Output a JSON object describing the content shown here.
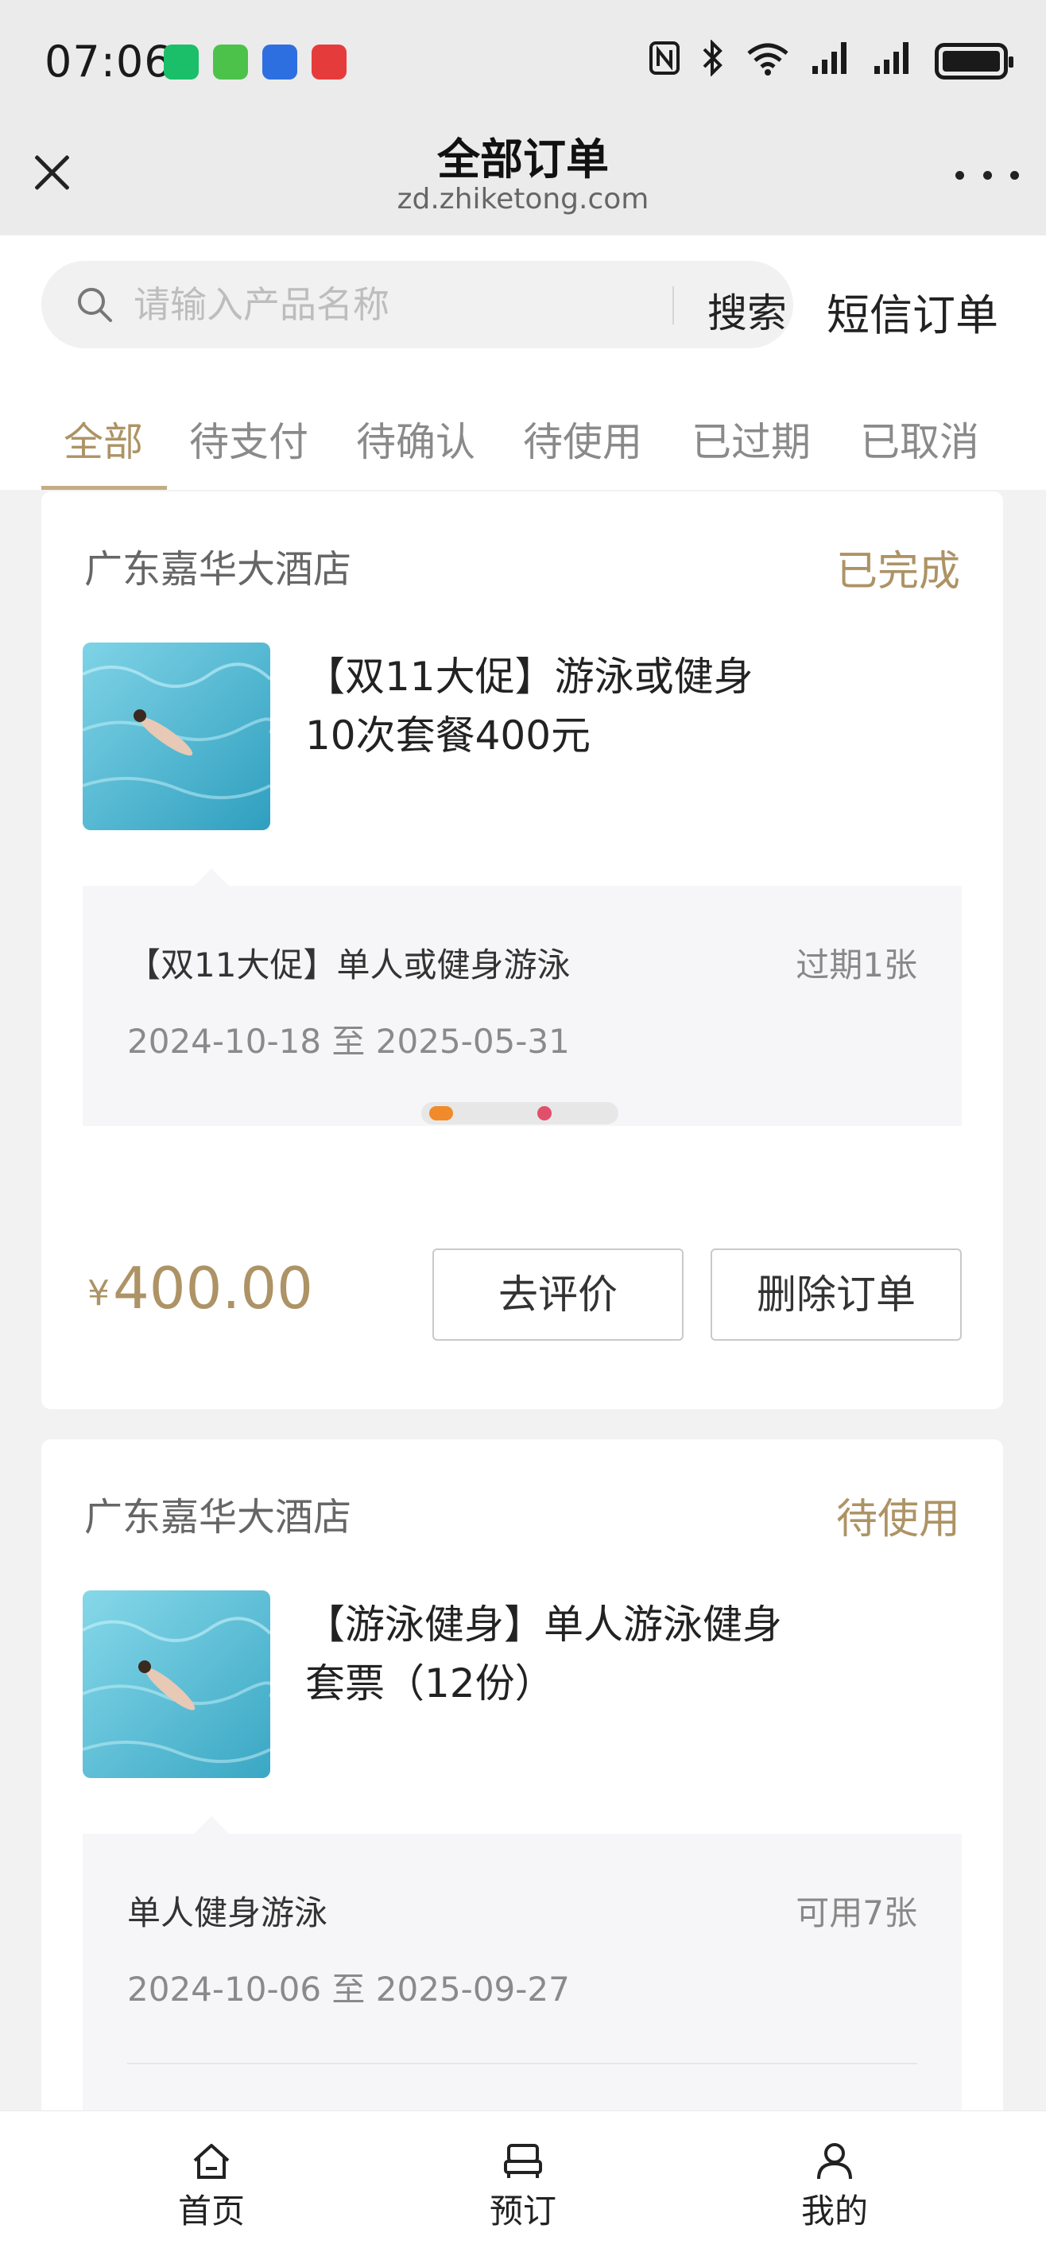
{
  "status_bar": {
    "time": "07:06",
    "app_icons": [
      {
        "name": "mi-home-app-icon",
        "color": "#1bbf6a"
      },
      {
        "name": "spreadsheet-app-icon",
        "color": "#4cc24a"
      },
      {
        "name": "blue-app-icon",
        "color": "#2d6fe0"
      },
      {
        "name": "huawei-app-icon",
        "color": "#e63b3b"
      }
    ],
    "icons": [
      "nfc-icon",
      "bluetooth-icon",
      "wifi-icon",
      "signal-icon",
      "signal-icon-2",
      "battery-icon"
    ],
    "battery_level": 1.0
  },
  "header": {
    "title": "全部订单",
    "domain": "zd.zhiketong.com"
  },
  "search": {
    "placeholder": "请输入产品名称",
    "value": "",
    "button_label": "搜索",
    "sms_orders_label": "短信订单"
  },
  "tabs": [
    {
      "label": "全部",
      "active": true
    },
    {
      "label": "待支付",
      "active": false
    },
    {
      "label": "待确认",
      "active": false
    },
    {
      "label": "待使用",
      "active": false
    },
    {
      "label": "已过期",
      "active": false
    },
    {
      "label": "已取消",
      "active": false
    }
  ],
  "orders": [
    {
      "store": "广东嘉华大酒店",
      "status": "已完成",
      "title": "【双11大促】游泳或健身10次套餐400元",
      "sub_name": "【双11大促】单人或健身游泳",
      "sub_qty": "过期1张",
      "sub_date": "2024-10-18 至 2025-05-31",
      "price_symbol": "¥",
      "price": "400.00",
      "buttons": [
        "去评价",
        "删除订单"
      ]
    },
    {
      "store": "广东嘉华大酒店",
      "status": "待使用",
      "title": "【游泳健身】单人游泳健身套票（12份）",
      "sub_name": "单人健身游泳",
      "sub_qty": "可用7张",
      "sub_date": "2024-10-06 至 2025-09-27"
    }
  ],
  "bottom_nav": [
    {
      "label": "首页",
      "icon": "home-icon"
    },
    {
      "label": "预订",
      "icon": "booking-icon"
    },
    {
      "label": "我的",
      "icon": "profile-icon"
    }
  ],
  "colors": {
    "accent": "#ad9365",
    "page_bg": "#f2f2f2",
    "header_bg": "#ebebeb"
  }
}
